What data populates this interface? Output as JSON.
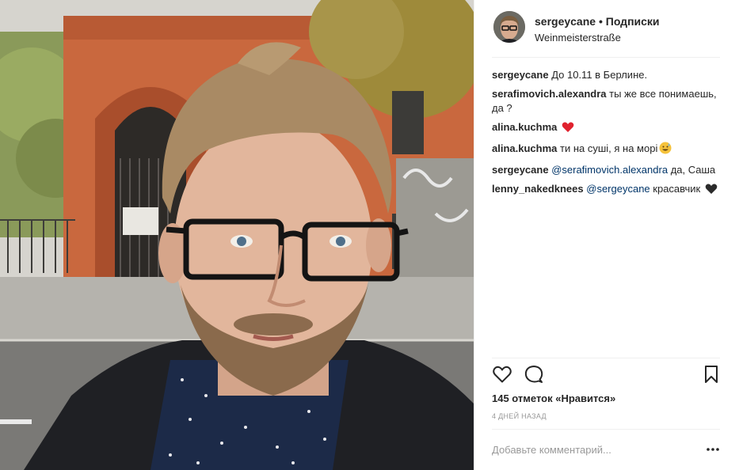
{
  "post": {
    "username": "sergeycane",
    "separator": "•",
    "follow_label": "Подписки",
    "location": "Weinmeisterstraße",
    "comments": [
      {
        "user": "sergeycane",
        "mention": "",
        "text": "До 10.11 в Берлине.",
        "emoji": ""
      },
      {
        "user": "serafimovich.alexandra",
        "mention": "",
        "text": "ты же все понимаешь, да ?",
        "emoji": ""
      },
      {
        "user": "alina.kuchma",
        "mention": "",
        "text": "",
        "emoji": "red-heart"
      },
      {
        "user": "alina.kuchma",
        "mention": "",
        "text": "ти на суші, я на морі",
        "emoji": "sweat-smile"
      },
      {
        "user": "sergeycane",
        "mention": "@serafimovich.alexandra",
        "text": "да, Саша",
        "emoji": ""
      },
      {
        "user": "lenny_nakedknees",
        "mention": "@sergeycane",
        "text": "красавчик",
        "emoji": "black-heart"
      }
    ],
    "likes": "145 отметок «Нравится»",
    "time_ago": "4 ДНЕЙ НАЗАД",
    "add_comment_placeholder": "Добавьте комментарий...",
    "icons": {
      "like": "heart-outline-icon",
      "comment": "comment-bubble-icon",
      "save": "bookmark-icon",
      "more": "ellipsis-icon"
    },
    "colors": {
      "mention": "#003569",
      "secondary_text": "#999999",
      "divider": "#efefef"
    }
  }
}
